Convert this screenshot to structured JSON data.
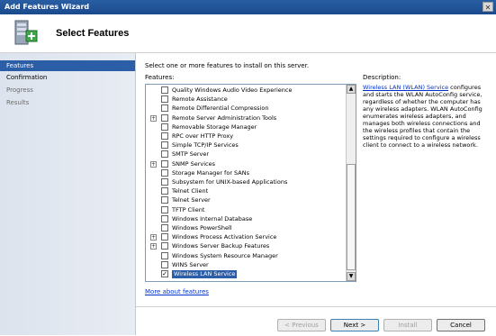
{
  "window": {
    "title": "Add Features Wizard",
    "close_glyph": "✕"
  },
  "header": {
    "title": "Select Features",
    "icon": "server-features-icon"
  },
  "sidebar": {
    "items": [
      {
        "label": "Features",
        "state": "active"
      },
      {
        "label": "Confirmation",
        "state": "normal"
      },
      {
        "label": "Progress",
        "state": "dim"
      },
      {
        "label": "Results",
        "state": "dim"
      }
    ]
  },
  "main": {
    "instruction": "Select one or more features to install on this server.",
    "features_label": "Features:",
    "description_label": "Description:",
    "description_link": "Wireless LAN (WLAN) Service",
    "description_text": "configures and starts the WLAN AutoConfig service, regardless of whether the computer has any wireless adapters. WLAN AutoConfig enumerates wireless adapters, and manages both wireless connections and the wireless profiles that contain the settings required to configure a wireless client to connect to a wireless network.",
    "more_link": "More about features",
    "features": [
      {
        "label": "Quality Windows Audio Video Experience",
        "expandable": false,
        "checked": false
      },
      {
        "label": "Remote Assistance",
        "expandable": false,
        "checked": false
      },
      {
        "label": "Remote Differential Compression",
        "expandable": false,
        "checked": false
      },
      {
        "label": "Remote Server Administration Tools",
        "expandable": true,
        "checked": false
      },
      {
        "label": "Removable Storage Manager",
        "expandable": false,
        "checked": false
      },
      {
        "label": "RPC over HTTP Proxy",
        "expandable": false,
        "checked": false
      },
      {
        "label": "Simple TCP/IP Services",
        "expandable": false,
        "checked": false
      },
      {
        "label": "SMTP Server",
        "expandable": false,
        "checked": false
      },
      {
        "label": "SNMP Services",
        "expandable": true,
        "checked": false
      },
      {
        "label": "Storage Manager for SANs",
        "expandable": false,
        "checked": false
      },
      {
        "label": "Subsystem for UNIX-based Applications",
        "expandable": false,
        "checked": false
      },
      {
        "label": "Telnet Client",
        "expandable": false,
        "checked": false
      },
      {
        "label": "Telnet Server",
        "expandable": false,
        "checked": false
      },
      {
        "label": "TFTP Client",
        "expandable": false,
        "checked": false
      },
      {
        "label": "Windows Internal Database",
        "expandable": false,
        "checked": false
      },
      {
        "label": "Windows PowerShell",
        "expandable": false,
        "checked": false
      },
      {
        "label": "Windows Process Activation Service",
        "expandable": true,
        "checked": false
      },
      {
        "label": "Windows Server Backup Features",
        "expandable": true,
        "checked": false
      },
      {
        "label": "Windows System Resource Manager",
        "expandable": false,
        "checked": false
      },
      {
        "label": "WINS Server",
        "expandable": false,
        "checked": false
      },
      {
        "label": "Wireless LAN Service",
        "expandable": false,
        "checked": true,
        "selected": true
      }
    ],
    "expander_glyph": "+",
    "check_glyph": "✓",
    "scroll_up_glyph": "▲",
    "scroll_down_glyph": "▼"
  },
  "buttons": {
    "previous": "< Previous",
    "next": "Next >",
    "install": "Install",
    "cancel": "Cancel"
  },
  "colors": {
    "titlebar": "#1a4a8c",
    "selection": "#2c5ea8",
    "link": "#0033cc"
  }
}
